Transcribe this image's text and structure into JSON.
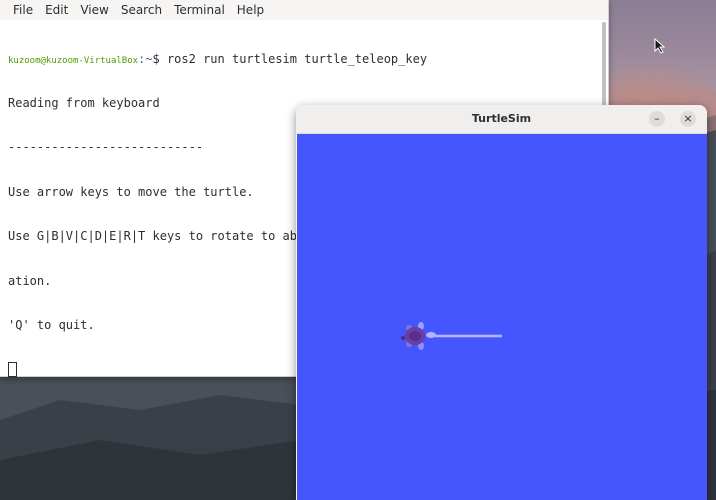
{
  "terminal": {
    "menu": [
      "File",
      "Edit",
      "View",
      "Search",
      "Terminal",
      "Help"
    ],
    "prompt_user": "kuzoom@kuzoom-VirtualBox",
    "prompt_path": ":~",
    "prompt_symbol": "$ ",
    "command": "ros2 run turtlesim turtle_teleop_key",
    "output": [
      "Reading from keyboard",
      "---------------------------",
      "Use arrow keys to move the turtle.",
      "Use G|B|V|C|D|E|R|T keys to rotate to absolute orientations. 'F' to cancel a rot",
      "ation.",
      "'Q' to quit."
    ]
  },
  "turtlesim": {
    "title": "TurtleSim",
    "minimize_glyph": "–",
    "close_glyph": "×",
    "background_color": "#4556ff",
    "pen_color": "#b3b8ff",
    "turtle_color": "#6b3fa0"
  }
}
